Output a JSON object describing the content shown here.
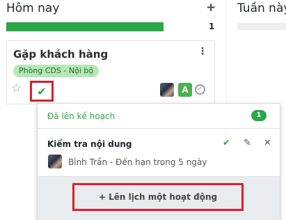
{
  "column": {
    "title": "Hôm nay",
    "add_icon": "+",
    "count": "1",
    "progress_fraction": 1.0,
    "accent": "#28a745"
  },
  "next_column": {
    "title": "Tuần này"
  },
  "card": {
    "title": "Gặp khách hàng",
    "tag": "Phòng CDS - Nội bộ",
    "avatar_letter": "A"
  },
  "popover": {
    "header": "Đã lên kế hoạch",
    "badge": "1",
    "activity": {
      "title": "Kiểm tra nội dung",
      "user": "Bình Trần",
      "separator": " - ",
      "due": "Đến hạn trong 5 ngày"
    },
    "schedule_button": "Lên lịch một hoạt động"
  },
  "icons": {
    "kebab": "kebab-menu-icon",
    "star": "star-icon",
    "check": "checkmark-icon",
    "edit": "pencil-icon",
    "delete": "close-icon",
    "plus": "plus-icon"
  }
}
